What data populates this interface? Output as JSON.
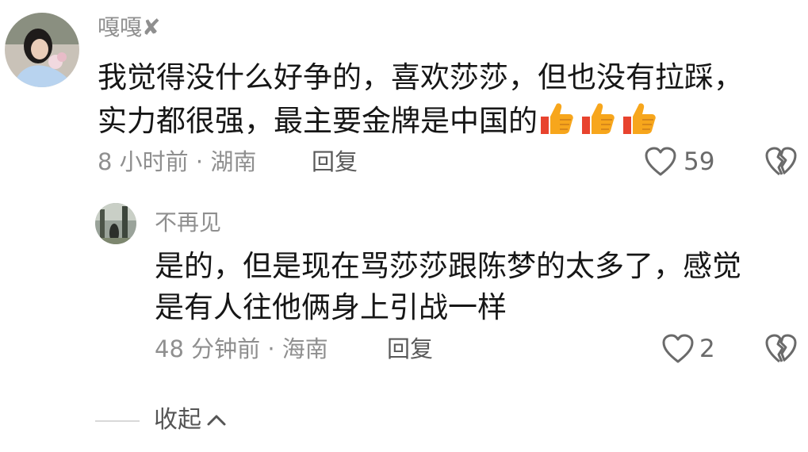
{
  "comment": {
    "username": "嘎嘎✘",
    "text_line1": "我觉得没什么好争的，喜欢莎莎，但也没有拉踩，",
    "text_line2": "实力都很强，最主要金牌是中国的",
    "emojis": [
      "thumbs-up-icon",
      "thumbs-up-icon",
      "thumbs-up-icon"
    ],
    "meta": "8 小时前 · 湖南",
    "reply_label": "回复",
    "like_count": "59"
  },
  "reply": {
    "username": "不再见",
    "text_line1": "是的，但是现在骂莎莎跟陈梦的太多了，感觉",
    "text_line2": "是有人往他俩身上引战一样",
    "meta": "48 分钟前 · 海南",
    "reply_label": "回复",
    "like_count": "2"
  },
  "collapse_label": "收起",
  "icons": {
    "like": "heart-outline-icon",
    "dislike": "broken-heart-icon",
    "collapse": "chevron-up-icon"
  },
  "colors": {
    "text_primary": "#161616",
    "text_secondary": "#8f8f8f",
    "emoji_orange": "#f7a61c",
    "emoji_red": "#e8432e"
  }
}
